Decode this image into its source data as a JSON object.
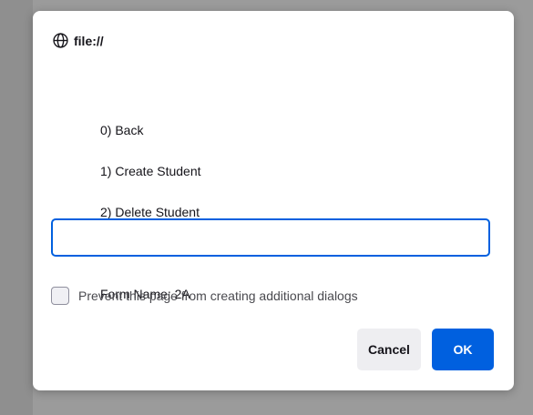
{
  "dialog": {
    "origin": "file://",
    "origin_icon": "globe-icon",
    "message_lines": [
      "0) Back",
      "1) Create Student",
      "2) Delete Student",
      "----------------------",
      "Form Name: 2A"
    ],
    "input_value": "",
    "checkbox_label": "Prevent this page from creating additional dialogs",
    "checkbox_checked": false,
    "cancel_label": "Cancel",
    "ok_label": "OK"
  },
  "colors": {
    "accent": "#0060df",
    "backdrop": "#9b9b9b"
  }
}
